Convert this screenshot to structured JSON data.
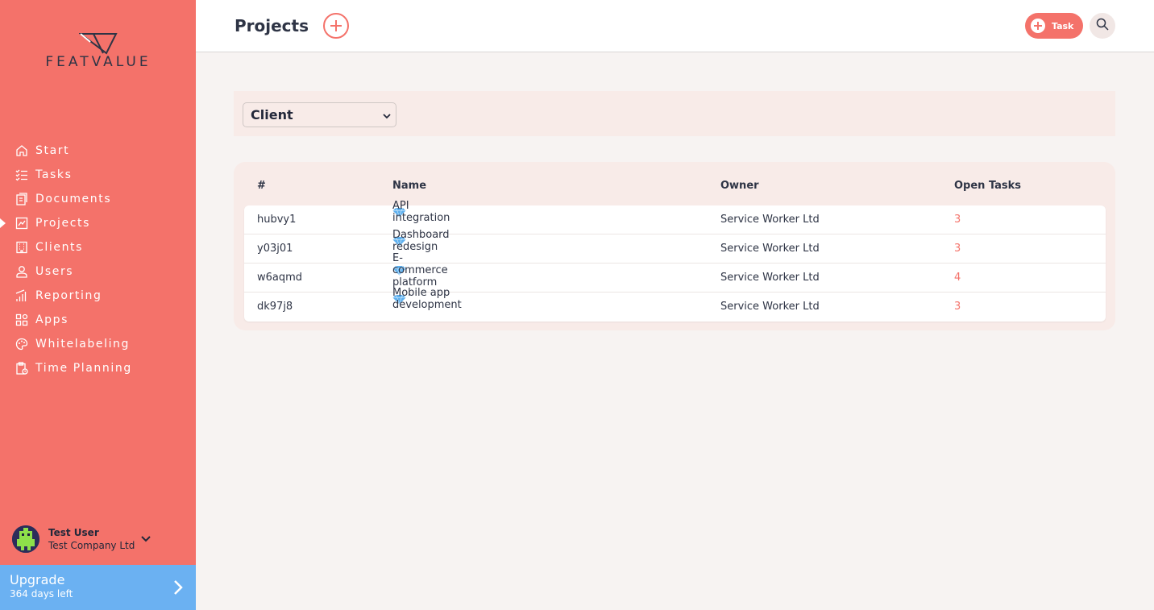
{
  "app": {
    "logo_text": "FEATVALUE"
  },
  "sidebar": {
    "items": [
      {
        "label": "Start",
        "icon": "home-icon"
      },
      {
        "label": "Tasks",
        "icon": "checklist-icon"
      },
      {
        "label": "Documents",
        "icon": "documents-icon"
      },
      {
        "label": "Projects",
        "icon": "chart-icon",
        "active": true
      },
      {
        "label": "Clients",
        "icon": "building-icon"
      },
      {
        "label": "Users",
        "icon": "user-icon"
      },
      {
        "label": "Reporting",
        "icon": "bar-chart-icon"
      },
      {
        "label": "Apps",
        "icon": "apps-icon"
      },
      {
        "label": "Whitelabeling",
        "icon": "palette-icon"
      },
      {
        "label": "Time Planning",
        "icon": "clipboard-clock-icon"
      }
    ],
    "user": {
      "name": "Test User",
      "company": "Test Company Ltd"
    },
    "upgrade": {
      "title": "Upgrade",
      "subtitle": "364 days left"
    }
  },
  "header": {
    "title": "Projects",
    "task_button_label": "Task"
  },
  "filter": {
    "client_select_value": "Client"
  },
  "table": {
    "columns": [
      "#",
      "Name",
      "Owner",
      "Open Tasks"
    ],
    "rows": [
      {
        "id": "hubvy1",
        "name": "API integration",
        "owner": "Service Worker Ltd",
        "open_tasks": "3"
      },
      {
        "id": "y03j01",
        "name": "Dashboard redesign",
        "owner": "Service Worker Ltd",
        "open_tasks": "3"
      },
      {
        "id": "w6aqmd",
        "name": "E-commerce platform",
        "owner": "Service Worker Ltd",
        "open_tasks": "4"
      },
      {
        "id": "dk97j8",
        "name": "Mobile app development",
        "owner": "Service Worker Ltd",
        "open_tasks": "3"
      }
    ]
  },
  "colors": {
    "brand": "#f4726a",
    "upgrade": "#6bb1f2",
    "text_dark": "#2e3445"
  }
}
